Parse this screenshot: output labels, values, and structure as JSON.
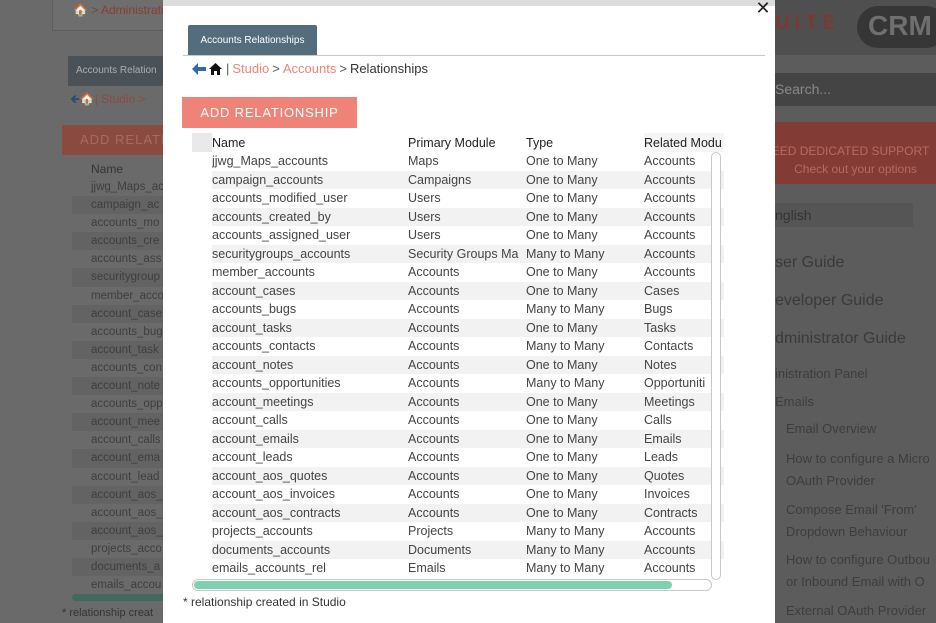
{
  "background": {
    "breadcrumb_home": "🏠",
    "breadcrumb_text": "> Administrati",
    "rel_tab": "Accounts Relation",
    "nav_back": "🡸",
    "nav_home": "🏠",
    "nav_text": "| Studio >",
    "add_button": "ADD RELATI",
    "list_header": "Name",
    "list_items": [
      "jjwg_Maps_ac",
      "campaign_ac",
      "accounts_mo",
      "accounts_cre",
      "accounts_ass",
      "securitygroup",
      "member_acco",
      "account_case",
      "accounts_bug",
      "account_task",
      "accounts_con",
      "account_note",
      "accounts_opp",
      "account_mee",
      "account_calls",
      "account_ema",
      "account_lead",
      "account_aos_",
      "account_aos_",
      "account_aos_",
      "projects_acco",
      "documents_a",
      "emails_accou"
    ],
    "note": "* relationship creat",
    "logo_suite": "UITE",
    "logo_crm": "CRM",
    "search_placeholder": "Search...",
    "support_line1": "EED DEDICATED SUPPORT",
    "support_line2": "Check out your options",
    "language": "nglish",
    "guides": [
      "ser Guide",
      "eveloper Guide",
      "dministrator Guide"
    ],
    "admin_panel": "inistration Panel",
    "emails": "Emails",
    "links": [
      "Email Overview",
      "How to configure a Micro",
      "OAuth Provider",
      "Compose Email 'From'",
      "Dropdown Behaviour",
      "How to configure Outbou",
      "or Inbound Email with O",
      "External OAuth Provider"
    ]
  },
  "modal": {
    "tab_label": "Accounts Relationships",
    "nav": {
      "separator1": "|",
      "studio": "Studio",
      "separator2": ">",
      "accounts": "Accounts",
      "separator3": ">",
      "current": "Relationships"
    },
    "add_button": "ADD RELATIONSHIP",
    "columns": [
      "Name",
      "Primary Module",
      "Type",
      "Related Modu"
    ],
    "rows": [
      [
        "jjwg_Maps_accounts",
        "Maps",
        "One to Many",
        "Accounts"
      ],
      [
        "campaign_accounts",
        "Campaigns",
        "One to Many",
        "Accounts"
      ],
      [
        "accounts_modified_user",
        "Users",
        "One to Many",
        "Accounts"
      ],
      [
        "accounts_created_by",
        "Users",
        "One to Many",
        "Accounts"
      ],
      [
        "accounts_assigned_user",
        "Users",
        "One to Many",
        "Accounts"
      ],
      [
        "securitygroups_accounts",
        "Security Groups Ma",
        "Many to Many",
        "Accounts"
      ],
      [
        "member_accounts",
        "Accounts",
        "One to Many",
        "Accounts"
      ],
      [
        "account_cases",
        "Accounts",
        "One to Many",
        "Cases"
      ],
      [
        "accounts_bugs",
        "Accounts",
        "Many to Many",
        "Bugs"
      ],
      [
        "account_tasks",
        "Accounts",
        "One to Many",
        "Tasks"
      ],
      [
        "accounts_contacts",
        "Accounts",
        "Many to Many",
        "Contacts"
      ],
      [
        "account_notes",
        "Accounts",
        "One to Many",
        "Notes"
      ],
      [
        "accounts_opportunities",
        "Accounts",
        "Many to Many",
        "Opportuniti"
      ],
      [
        "account_meetings",
        "Accounts",
        "One to Many",
        "Meetings"
      ],
      [
        "account_calls",
        "Accounts",
        "One to Many",
        "Calls"
      ],
      [
        "account_emails",
        "Accounts",
        "One to Many",
        "Emails"
      ],
      [
        "account_leads",
        "Accounts",
        "One to Many",
        "Leads"
      ],
      [
        "account_aos_quotes",
        "Accounts",
        "One to Many",
        "Quotes"
      ],
      [
        "account_aos_invoices",
        "Accounts",
        "One to Many",
        "Invoices"
      ],
      [
        "account_aos_contracts",
        "Accounts",
        "One to Many",
        "Contracts"
      ],
      [
        "projects_accounts",
        "Projects",
        "Many to Many",
        "Accounts"
      ],
      [
        "documents_accounts",
        "Documents",
        "Many to Many",
        "Accounts"
      ],
      [
        "emails_accounts_rel",
        "Emails",
        "Many to Many",
        "Accounts"
      ]
    ],
    "note": "* relationship created in Studio",
    "close_symbol": "✕"
  },
  "colors": {
    "accent": "#f08377",
    "tab": "#536d7d",
    "scroll_thumb": "#7fd0b1"
  }
}
